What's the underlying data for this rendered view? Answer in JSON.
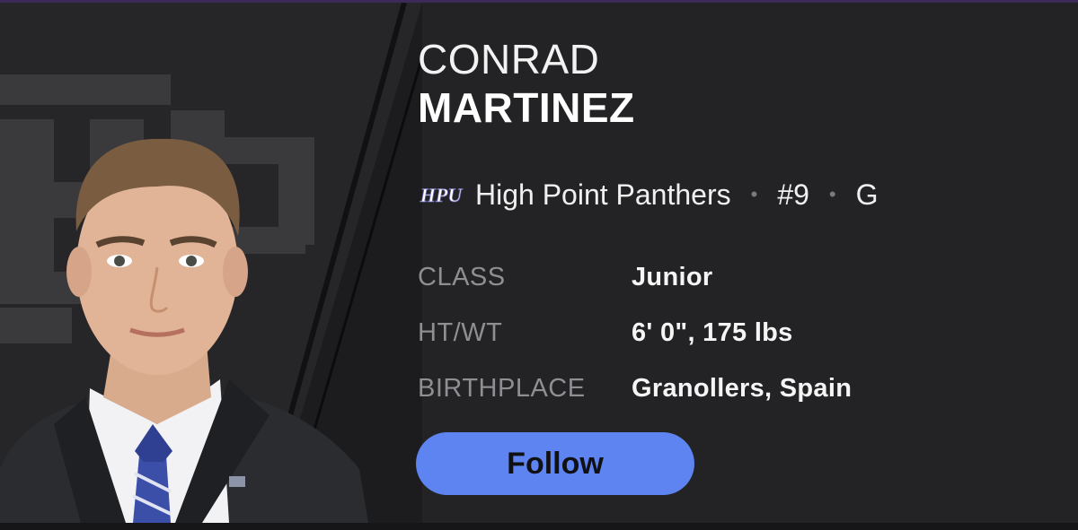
{
  "player": {
    "first_name": "CONRAD",
    "last_name": "MARTINEZ"
  },
  "team": {
    "name": "High Point Panthers",
    "number": "#9",
    "position": "G",
    "separator": "•",
    "logo_text": "HPU"
  },
  "stats": [
    {
      "label": "CLASS",
      "value": "Junior"
    },
    {
      "label": "HT/WT",
      "value": "6' 0\", 175 lbs"
    },
    {
      "label": "BIRTHPLACE",
      "value": "Granollers, Spain"
    }
  ],
  "follow": {
    "label": "Follow"
  },
  "colors": {
    "background": "#232325",
    "accent_button": "#5d84f0",
    "muted_label": "#8e8e93"
  }
}
